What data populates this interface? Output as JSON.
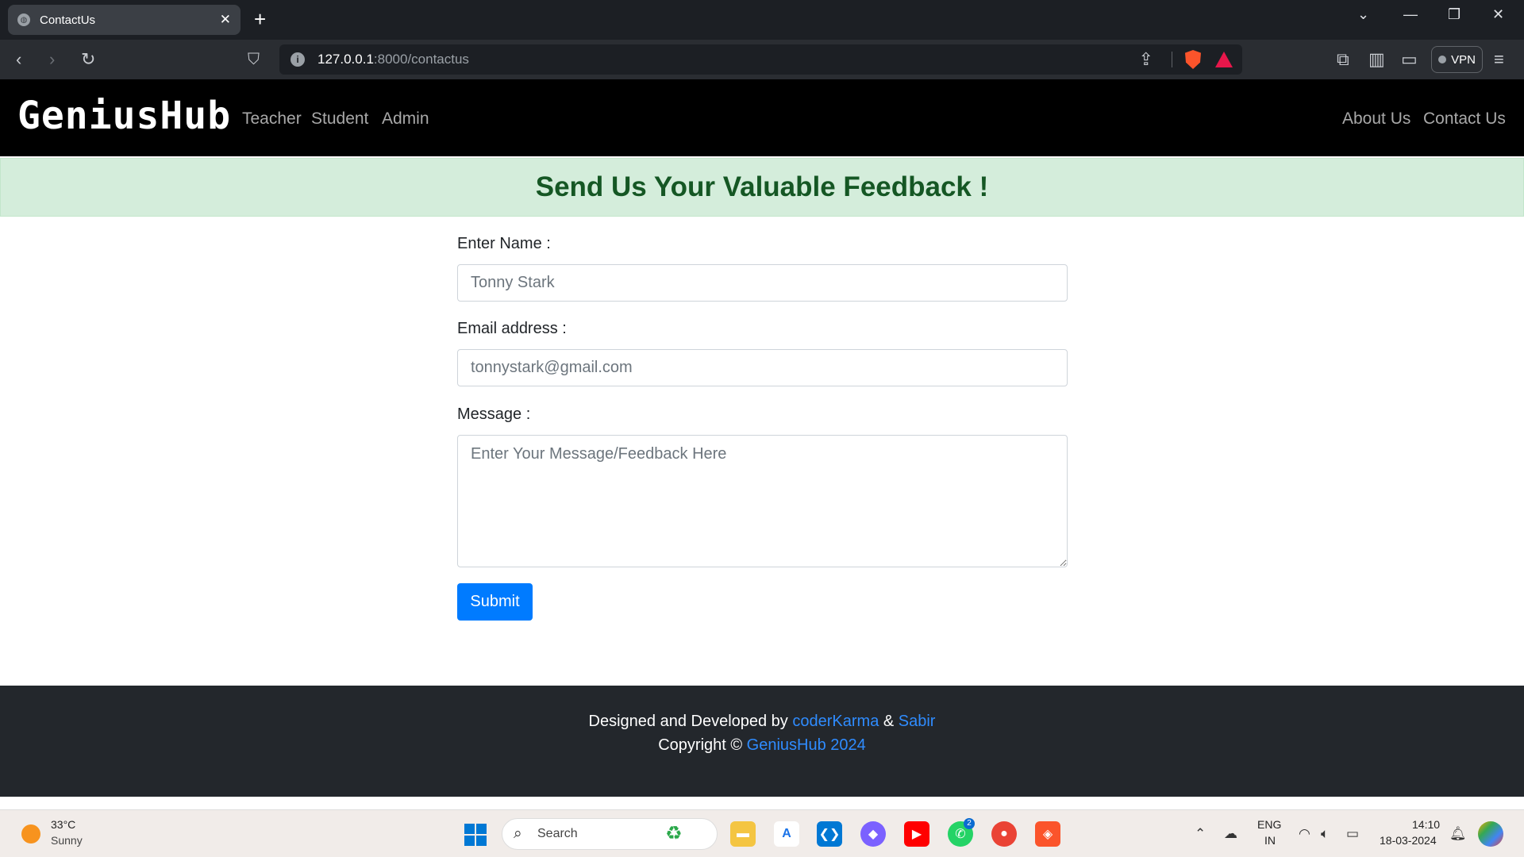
{
  "browser": {
    "tab_title": "ContactUs",
    "tab_close": "✕",
    "new_tab": "+",
    "url_host": "127.0.0.1",
    "url_path": ":8000/contactus",
    "vpn_label": "VPN"
  },
  "site": {
    "brand": "GeniusHub",
    "nav_left": [
      "Teacher",
      "Student",
      "Admin"
    ],
    "nav_right": [
      "About Us",
      "Contact Us"
    ]
  },
  "banner": {
    "title": "Send Us Your Valuable Feedback !",
    "background": "#d4eddb",
    "text_color": "#155724"
  },
  "form": {
    "name_label": "Enter Name :",
    "name_placeholder": "Tonny Stark",
    "email_label": "Email address :",
    "email_placeholder": "tonnystark@gmail.com",
    "message_label": "Message :",
    "message_placeholder": "Enter Your Message/Feedback Here",
    "submit_label": "Submit",
    "accent": "#007bff"
  },
  "footer": {
    "designed_prefix": "Designed and Developed by",
    "author1": "coderKarma",
    "amp": "&",
    "author2": "Sabir",
    "copyright_prefix": "Copyright ©",
    "copyright_link": "GeniusHub 2024",
    "link_color": "#2f8cff"
  },
  "taskbar": {
    "weather_temp": "33°C",
    "weather_cond": "Sunny",
    "search_label": "Search",
    "whatsapp_badge": "2",
    "lang_line1": "ENG",
    "lang_line2": "IN",
    "time": "14:10",
    "date": "18-03-2024"
  }
}
